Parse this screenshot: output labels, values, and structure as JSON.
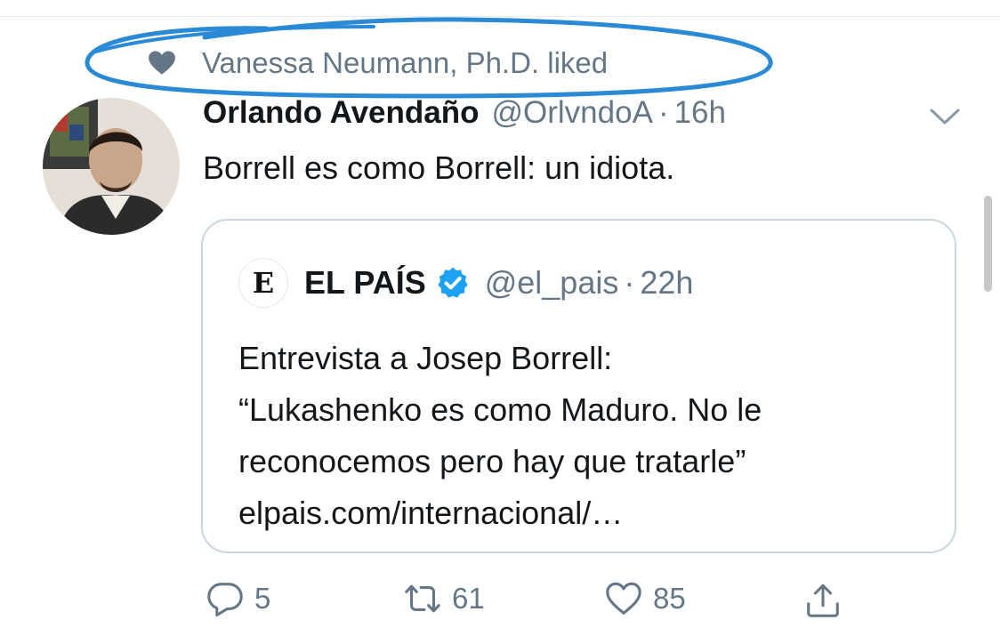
{
  "social_context": {
    "text": "Vanessa Neumann, Ph.D. liked",
    "icon": "heart-icon"
  },
  "tweet": {
    "author_name": "Orlando Avendaño",
    "handle": "@OrlvndoA",
    "separator": "·",
    "age": "16h",
    "text": "Borrell es como Borrell: un idiota."
  },
  "quoted_tweet": {
    "logo_letter": "E",
    "author_name": "EL PAÍS",
    "verified": true,
    "handle": "@el_pais",
    "separator": "·",
    "age": "22h",
    "lines": [
      "Entrevista a Josep Borrell:",
      "“Lukashenko es como Maduro. No le",
      "reconocemos pero hay que tratarle”",
      "elpais.com/internacional/…"
    ]
  },
  "actions": {
    "reply_count": "5",
    "retweet_count": "61",
    "like_count": "85"
  },
  "colors": {
    "text_primary": "#14171a",
    "text_secondary": "#657786",
    "verified_blue": "#1da1f2",
    "ink_annotation": "#2a8ad6",
    "card_border": "#ccd6dd"
  }
}
